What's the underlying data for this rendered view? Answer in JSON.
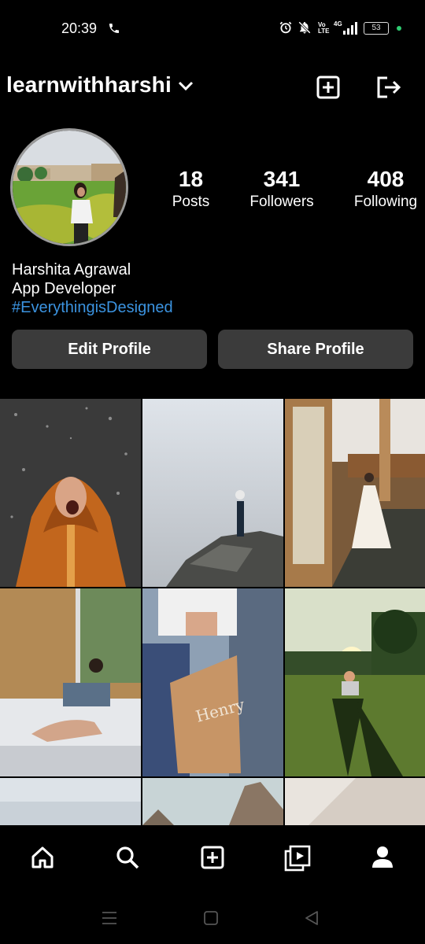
{
  "status_bar": {
    "time": "20:39",
    "battery": "53",
    "network": "4G",
    "volte": "Vo LTE",
    "colors": {
      "charging_dot": "#2ecc71"
    }
  },
  "header": {
    "username": "learnwithharshi",
    "icons": [
      "chevron-down-icon",
      "add-post-icon",
      "logout-icon"
    ]
  },
  "profile": {
    "stats": [
      {
        "value": "18",
        "label": "Posts"
      },
      {
        "value": "341",
        "label": "Followers"
      },
      {
        "value": "408",
        "label": "Following"
      }
    ],
    "name": "Harshita Agrawal",
    "title": "App Developer",
    "hashtag": "#EverythingisDesigned",
    "colors": {
      "hashtag": "#3b93e0",
      "button_bg": "#3b3b3b"
    }
  },
  "buttons": {
    "edit": "Edit Profile",
    "share": "Share Profile"
  },
  "grid": {
    "posts": [
      {
        "name": "post-rain-raincoat"
      },
      {
        "name": "post-cliff-fog"
      },
      {
        "name": "post-bride-window"
      },
      {
        "name": "post-bedroom-stretch"
      },
      {
        "name": "post-shopping-bag"
      },
      {
        "name": "post-golf-sunset"
      },
      {
        "name": "post-sky-partial"
      },
      {
        "name": "post-mountains-partial"
      },
      {
        "name": "post-wall-partial"
      }
    ]
  },
  "bottom_nav": {
    "items": [
      "home-icon",
      "search-icon",
      "add-icon",
      "reels-icon",
      "profile-icon"
    ]
  },
  "system_nav": {
    "items": [
      "menu-icon",
      "home-square-icon",
      "back-icon"
    ]
  }
}
